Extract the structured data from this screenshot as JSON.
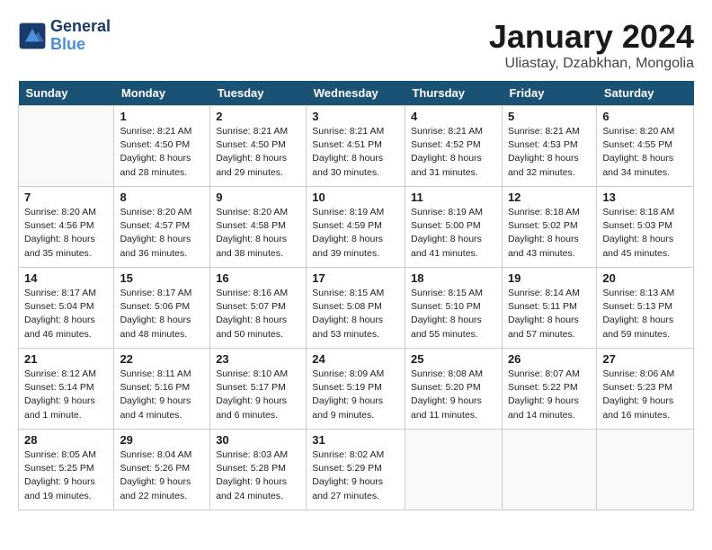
{
  "header": {
    "logo_line1": "General",
    "logo_line2": "Blue",
    "month": "January 2024",
    "location": "Uliastay, Dzabkhan, Mongolia"
  },
  "days_of_week": [
    "Sunday",
    "Monday",
    "Tuesday",
    "Wednesday",
    "Thursday",
    "Friday",
    "Saturday"
  ],
  "weeks": [
    [
      {
        "day": "",
        "info": ""
      },
      {
        "day": "1",
        "info": "Sunrise: 8:21 AM\nSunset: 4:50 PM\nDaylight: 8 hours\nand 28 minutes."
      },
      {
        "day": "2",
        "info": "Sunrise: 8:21 AM\nSunset: 4:50 PM\nDaylight: 8 hours\nand 29 minutes."
      },
      {
        "day": "3",
        "info": "Sunrise: 8:21 AM\nSunset: 4:51 PM\nDaylight: 8 hours\nand 30 minutes."
      },
      {
        "day": "4",
        "info": "Sunrise: 8:21 AM\nSunset: 4:52 PM\nDaylight: 8 hours\nand 31 minutes."
      },
      {
        "day": "5",
        "info": "Sunrise: 8:21 AM\nSunset: 4:53 PM\nDaylight: 8 hours\nand 32 minutes."
      },
      {
        "day": "6",
        "info": "Sunrise: 8:20 AM\nSunset: 4:55 PM\nDaylight: 8 hours\nand 34 minutes."
      }
    ],
    [
      {
        "day": "7",
        "info": "Sunrise: 8:20 AM\nSunset: 4:56 PM\nDaylight: 8 hours\nand 35 minutes."
      },
      {
        "day": "8",
        "info": "Sunrise: 8:20 AM\nSunset: 4:57 PM\nDaylight: 8 hours\nand 36 minutes."
      },
      {
        "day": "9",
        "info": "Sunrise: 8:20 AM\nSunset: 4:58 PM\nDaylight: 8 hours\nand 38 minutes."
      },
      {
        "day": "10",
        "info": "Sunrise: 8:19 AM\nSunset: 4:59 PM\nDaylight: 8 hours\nand 39 minutes."
      },
      {
        "day": "11",
        "info": "Sunrise: 8:19 AM\nSunset: 5:00 PM\nDaylight: 8 hours\nand 41 minutes."
      },
      {
        "day": "12",
        "info": "Sunrise: 8:18 AM\nSunset: 5:02 PM\nDaylight: 8 hours\nand 43 minutes."
      },
      {
        "day": "13",
        "info": "Sunrise: 8:18 AM\nSunset: 5:03 PM\nDaylight: 8 hours\nand 45 minutes."
      }
    ],
    [
      {
        "day": "14",
        "info": "Sunrise: 8:17 AM\nSunset: 5:04 PM\nDaylight: 8 hours\nand 46 minutes."
      },
      {
        "day": "15",
        "info": "Sunrise: 8:17 AM\nSunset: 5:06 PM\nDaylight: 8 hours\nand 48 minutes."
      },
      {
        "day": "16",
        "info": "Sunrise: 8:16 AM\nSunset: 5:07 PM\nDaylight: 8 hours\nand 50 minutes."
      },
      {
        "day": "17",
        "info": "Sunrise: 8:15 AM\nSunset: 5:08 PM\nDaylight: 8 hours\nand 53 minutes."
      },
      {
        "day": "18",
        "info": "Sunrise: 8:15 AM\nSunset: 5:10 PM\nDaylight: 8 hours\nand 55 minutes."
      },
      {
        "day": "19",
        "info": "Sunrise: 8:14 AM\nSunset: 5:11 PM\nDaylight: 8 hours\nand 57 minutes."
      },
      {
        "day": "20",
        "info": "Sunrise: 8:13 AM\nSunset: 5:13 PM\nDaylight: 8 hours\nand 59 minutes."
      }
    ],
    [
      {
        "day": "21",
        "info": "Sunrise: 8:12 AM\nSunset: 5:14 PM\nDaylight: 9 hours\nand 1 minute."
      },
      {
        "day": "22",
        "info": "Sunrise: 8:11 AM\nSunset: 5:16 PM\nDaylight: 9 hours\nand 4 minutes."
      },
      {
        "day": "23",
        "info": "Sunrise: 8:10 AM\nSunset: 5:17 PM\nDaylight: 9 hours\nand 6 minutes."
      },
      {
        "day": "24",
        "info": "Sunrise: 8:09 AM\nSunset: 5:19 PM\nDaylight: 9 hours\nand 9 minutes."
      },
      {
        "day": "25",
        "info": "Sunrise: 8:08 AM\nSunset: 5:20 PM\nDaylight: 9 hours\nand 11 minutes."
      },
      {
        "day": "26",
        "info": "Sunrise: 8:07 AM\nSunset: 5:22 PM\nDaylight: 9 hours\nand 14 minutes."
      },
      {
        "day": "27",
        "info": "Sunrise: 8:06 AM\nSunset: 5:23 PM\nDaylight: 9 hours\nand 16 minutes."
      }
    ],
    [
      {
        "day": "28",
        "info": "Sunrise: 8:05 AM\nSunset: 5:25 PM\nDaylight: 9 hours\nand 19 minutes."
      },
      {
        "day": "29",
        "info": "Sunrise: 8:04 AM\nSunset: 5:26 PM\nDaylight: 9 hours\nand 22 minutes."
      },
      {
        "day": "30",
        "info": "Sunrise: 8:03 AM\nSunset: 5:28 PM\nDaylight: 9 hours\nand 24 minutes."
      },
      {
        "day": "31",
        "info": "Sunrise: 8:02 AM\nSunset: 5:29 PM\nDaylight: 9 hours\nand 27 minutes."
      },
      {
        "day": "",
        "info": ""
      },
      {
        "day": "",
        "info": ""
      },
      {
        "day": "",
        "info": ""
      }
    ]
  ]
}
